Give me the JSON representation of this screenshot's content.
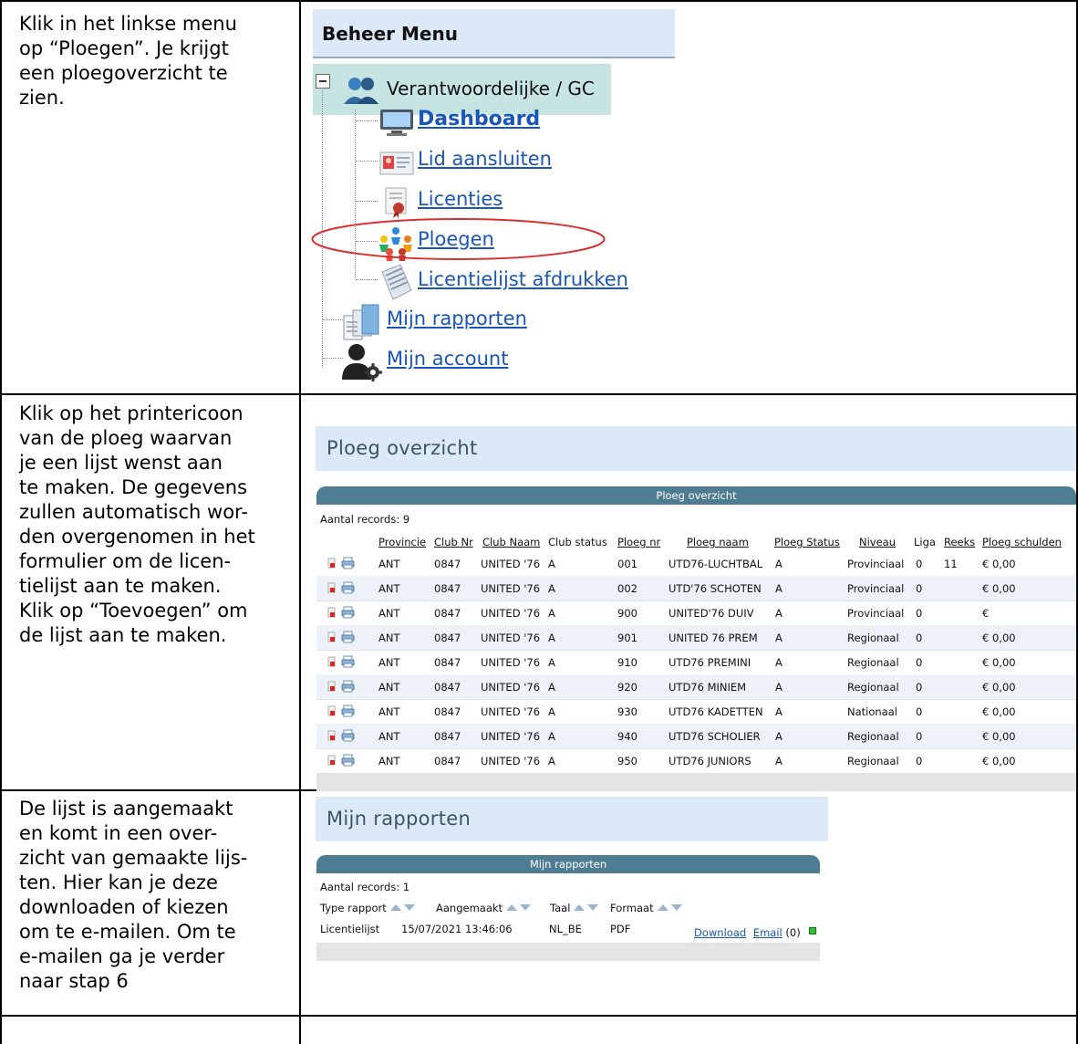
{
  "instructions": {
    "step1": [
      "Klik in het linkse menu",
      "op “Ploegen”. Je krijgt",
      "een ploegoverzicht te",
      "zien."
    ],
    "step2": [
      "Klik op het printericoon",
      "van de ploeg waarvan",
      "je een lijst wenst aan",
      "te maken. De gegevens",
      "zullen automatisch wor-",
      "den overgenomen in het",
      "formulier om de licen-",
      "tielijst aan te maken.",
      "Klik op “Toevoegen” om",
      "de lijst aan te maken."
    ],
    "step3": [
      "De lijst is aangemaakt",
      "en komt in een over-",
      "zicht van gemaakte lijs-",
      "ten. Hier kan je deze",
      "downloaden of kiezen",
      "om te e-mailen. Om te",
      "e-mailen ga je verder",
      "naar stap 6"
    ]
  },
  "menu": {
    "header": "Beheer Menu",
    "root": "Verantwoordelijke / GC",
    "items": [
      {
        "label": "Dashboard",
        "icon": "monitor-icon"
      },
      {
        "label": "Lid aansluiten",
        "icon": "id-card-icon"
      },
      {
        "label": "Licenties",
        "icon": "certificate-icon"
      },
      {
        "label": "Ploegen",
        "icon": "team-icon"
      },
      {
        "label": "Licentielijst afdrukken",
        "icon": "print-list-icon"
      }
    ],
    "top_items": [
      {
        "label": "Mijn rapporten",
        "icon": "reports-icon"
      },
      {
        "label": "Mijn account",
        "icon": "account-icon"
      }
    ],
    "highlight_color": "#d93030"
  },
  "ploeg": {
    "title": "Ploeg overzicht",
    "grid_title": "Ploeg overzicht",
    "records": "Aantal records: 9",
    "columns": [
      "Provincie",
      "Club Nr",
      "Club Naam",
      "Club status",
      "Ploeg nr",
      "Ploeg naam",
      "Ploeg Status",
      "Niveau",
      "Liga",
      "Reeks",
      "Ploeg schulden"
    ],
    "rows": [
      [
        "ANT",
        "0847",
        "UNITED '76",
        "A",
        "001",
        "UTD76-LUCHTBAL",
        "A",
        "Provinciaal",
        "0",
        "11",
        "€ 0,00"
      ],
      [
        "ANT",
        "0847",
        "UNITED '76",
        "A",
        "002",
        "UTD'76 SCHOTEN",
        "A",
        "Provinciaal",
        "0",
        "",
        "€ 0,00"
      ],
      [
        "ANT",
        "0847",
        "UNITED '76",
        "A",
        "900",
        "UNITED'76 DUIV",
        "A",
        "Provinciaal",
        "0",
        "",
        "€"
      ],
      [
        "ANT",
        "0847",
        "UNITED '76",
        "A",
        "901",
        "UNITED 76 PREM",
        "A",
        "Regionaal",
        "0",
        "",
        "€ 0,00"
      ],
      [
        "ANT",
        "0847",
        "UNITED '76",
        "A",
        "910",
        "UTD76 PREMINI",
        "A",
        "Regionaal",
        "0",
        "",
        "€ 0,00"
      ],
      [
        "ANT",
        "0847",
        "UNITED '76",
        "A",
        "920",
        "UTD76 MINIEM",
        "A",
        "Regionaal",
        "0",
        "",
        "€ 0,00"
      ],
      [
        "ANT",
        "0847",
        "UNITED '76",
        "A",
        "930",
        "UTD76 KADETTEN",
        "A",
        "Nationaal",
        "0",
        "",
        "€ 0,00"
      ],
      [
        "ANT",
        "0847",
        "UNITED '76",
        "A",
        "940",
        "UTD76 SCHOLIER",
        "A",
        "Regionaal",
        "0",
        "",
        "€ 0,00"
      ],
      [
        "ANT",
        "0847",
        "UNITED '76",
        "A",
        "950",
        "UTD76 JUNIORS",
        "A",
        "Regionaal",
        "0",
        "",
        "€ 0,00"
      ]
    ]
  },
  "rapporten": {
    "title": "Mijn rapporten",
    "grid_title": "Mijn rapporten",
    "records": "Aantal records: 1",
    "columns": [
      "Type rapport",
      "Aangemaakt",
      "Taal",
      "Formaat"
    ],
    "row": {
      "type": "Licentielijst",
      "created": "15/07/2021 13:46:06",
      "lang": "NL_BE",
      "format": "PDF",
      "download": "Download",
      "email": "Email",
      "count": "(0)"
    }
  }
}
